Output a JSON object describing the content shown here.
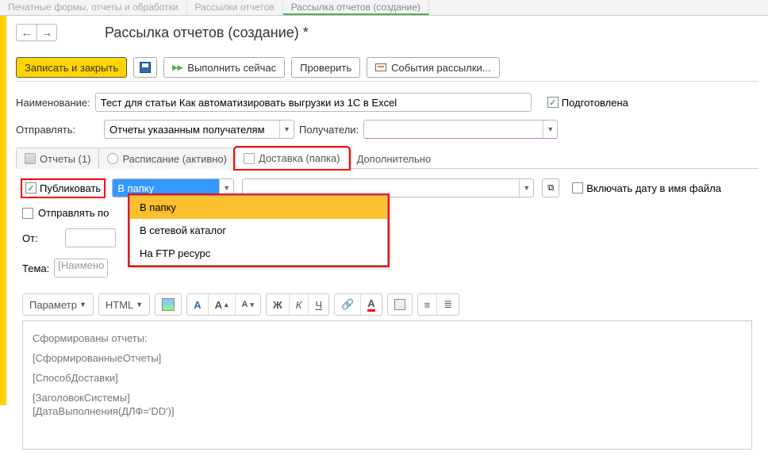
{
  "topTabs": {
    "t1": "Печатные формы, отчеты и обработки",
    "t2": "Рассылки отчетов",
    "t3": "Рассылка отчетов (создание)"
  },
  "title": "Рассылка отчетов (создание) *",
  "nav": {
    "back": "←",
    "fwd": "→"
  },
  "toolbar": {
    "save_close": "Записать и закрыть",
    "run": "Выполнить сейчас",
    "check": "Проверить",
    "events": "События рассылки..."
  },
  "fields": {
    "name_label": "Наименование:",
    "name_value": "Тест для статьи Как автоматизировать выгрузки из 1С в Excel",
    "prepared": "Подготовлена",
    "send_label": "Отправлять:",
    "send_value": "Отчеты указанным получателям",
    "recip_label": "Получатели:",
    "recip_value": ""
  },
  "tabs": {
    "reports": "Отчеты (1)",
    "schedule": "Расписание (активно)",
    "delivery": "Доставка (папка)",
    "extra": "Дополнительно"
  },
  "delivery": {
    "publish": "Публиковать",
    "folder_value": "В папку",
    "options": [
      "В папку",
      "В сетевой каталог",
      "На FTP ресурс"
    ],
    "include_date": "Включать дату в имя файла",
    "send_file": "Отправлять по",
    "from": "От:",
    "subject": "Тема:",
    "subject_ph": "[Наимено"
  },
  "editor": {
    "param": "Параметр",
    "html": "HTML",
    "A": "A",
    "Zh": "Ж",
    "K": "К",
    "Ch": "Ч"
  },
  "body": {
    "l1": "Сформированы отчеты:",
    "l2": "[СформированныеОтчеты]",
    "l3": "[СпособДоставки]",
    "l4": "[ЗаголовокСистемы]",
    "l5": "[ДатаВыполнения(ДЛФ='DD')]"
  }
}
